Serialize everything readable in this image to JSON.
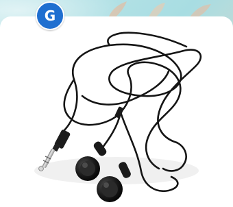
{
  "badge": {
    "letter": "G",
    "color": "#1f6fd0"
  },
  "background": {
    "primary_color": "#a8dde2",
    "accent_color": "#f3d3bf"
  },
  "image": {
    "subject_icon": "earphones-icon"
  }
}
